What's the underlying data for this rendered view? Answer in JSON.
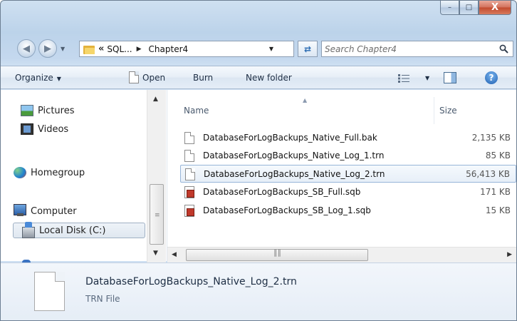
{
  "window": {
    "caption_buttons": {
      "minimize": "–",
      "maximize": "□",
      "close": "X"
    },
    "accent_color": "#3a73c2",
    "selection_color": "#97b5d8"
  },
  "address_bar": {
    "overflow_chevron": "«",
    "crumbs": [
      "SQL...",
      "Chapter4"
    ],
    "refresh_icon": "refresh-icon",
    "search_placeholder": "Search Chapter4"
  },
  "toolbar": {
    "organize": "Organize",
    "open": "Open",
    "burn": "Burn",
    "new_folder": "New folder"
  },
  "nav_pane": {
    "items": [
      {
        "label": "Pictures",
        "icon": "pictures-icon"
      },
      {
        "label": "Videos",
        "icon": "videos-icon"
      },
      {
        "label": "Homegroup",
        "icon": "homegroup-icon"
      },
      {
        "label": "Computer",
        "icon": "computer-icon"
      },
      {
        "label": "Local Disk (C:)",
        "icon": "disk-icon",
        "selected": true
      }
    ]
  },
  "file_list": {
    "columns": {
      "name": "Name",
      "size": "Size"
    },
    "rows": [
      {
        "name": "DatabaseForLogBackups_Native_Full.bak",
        "size": "2,135 KB",
        "icon": "blank-file-icon"
      },
      {
        "name": "DatabaseForLogBackups_Native_Log_1.trn",
        "size": "85 KB",
        "icon": "blank-file-icon"
      },
      {
        "name": "DatabaseForLogBackups_Native_Log_2.trn",
        "size": "56,413 KB",
        "icon": "blank-file-icon",
        "selected": true
      },
      {
        "name": "DatabaseForLogBackups_SB_Full.sqb",
        "size": "171 KB",
        "icon": "sqb-file-icon"
      },
      {
        "name": "DatabaseForLogBackups_SB_Log_1.sqb",
        "size": "15 KB",
        "icon": "sqb-file-icon"
      }
    ]
  },
  "details": {
    "filename": "DatabaseForLogBackups_Native_Log_2.trn",
    "filetype": "TRN File"
  }
}
